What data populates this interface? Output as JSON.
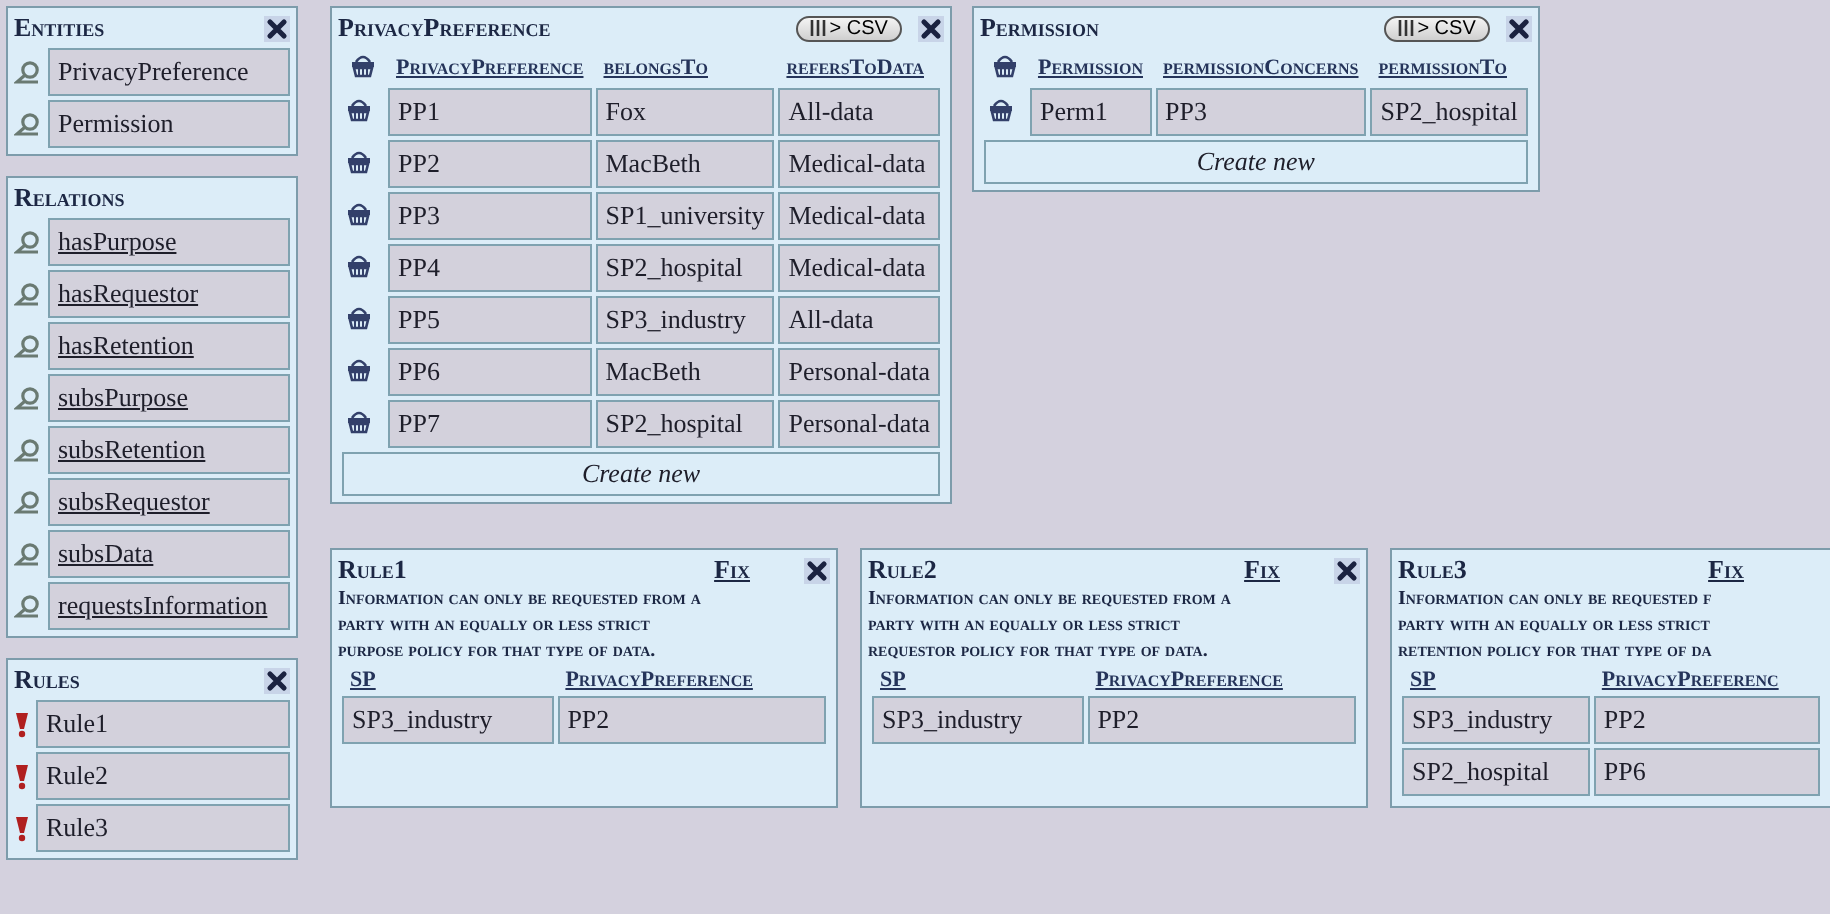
{
  "sidebar": [
    {
      "title": "Entities",
      "closable": true,
      "items": [
        {
          "label": "PrivacyPreference",
          "kind": "entity"
        },
        {
          "label": "Permission",
          "kind": "entity"
        }
      ]
    },
    {
      "title": "Relations",
      "closable": false,
      "items": [
        {
          "label": "hasPurpose",
          "kind": "relation"
        },
        {
          "label": "hasRequestor",
          "kind": "relation"
        },
        {
          "label": "hasRetention",
          "kind": "relation"
        },
        {
          "label": "subsPurpose",
          "kind": "relation"
        },
        {
          "label": "subsRetention",
          "kind": "relation"
        },
        {
          "label": "subsRequestor",
          "kind": "relation"
        },
        {
          "label": "subsData",
          "kind": "relation"
        },
        {
          "label": "requestsInformation",
          "kind": "relation"
        }
      ]
    },
    {
      "title": "Rules",
      "closable": true,
      "items": [
        {
          "label": "Rule1",
          "kind": "rule"
        },
        {
          "label": "Rule2",
          "kind": "rule"
        },
        {
          "label": "Rule3",
          "kind": "rule"
        }
      ]
    }
  ],
  "tables": [
    {
      "title": "PrivacyPreference",
      "csv_button": "> CSV",
      "columns": [
        "PrivacyPreference",
        "belongsTo",
        "refersToData"
      ],
      "rows": [
        [
          "PP1",
          "Fox",
          "All-data"
        ],
        [
          "PP2",
          "MacBeth",
          "Medical-data"
        ],
        [
          "PP3",
          "SP1_university",
          "Medical-data"
        ],
        [
          "PP4",
          "SP2_hospital",
          "Medical-data"
        ],
        [
          "PP5",
          "SP3_industry",
          "All-data"
        ],
        [
          "PP6",
          "MacBeth",
          "Personal-data"
        ],
        [
          "PP7",
          "SP2_hospital",
          "Personal-data"
        ]
      ],
      "create_new": "Create new"
    },
    {
      "title": "Permission",
      "csv_button": "> CSV",
      "columns": [
        "Permission",
        "permissionConcerns",
        "permissionTo"
      ],
      "rows": [
        [
          "Perm1",
          "PP3",
          "SP2_hospital"
        ]
      ],
      "create_new": "Create new"
    }
  ],
  "rules": [
    {
      "title": "Rule1",
      "fix": "Fix",
      "closable": true,
      "description_lines": [
        "Information can only be requested from a",
        "party with an equally or less strict",
        "purpose policy for that type of data."
      ],
      "columns": [
        "SP",
        "PrivacyPreference"
      ],
      "rows": [
        [
          "SP3_industry",
          "PP2"
        ]
      ]
    },
    {
      "title": "Rule2",
      "fix": "Fix",
      "closable": true,
      "description_lines": [
        "Information can only be requested from a",
        "party with an equally or less strict",
        "requestor policy for that type of data."
      ],
      "columns": [
        "SP",
        "PrivacyPreference"
      ],
      "rows": [
        [
          "SP3_industry",
          "PP2"
        ]
      ]
    },
    {
      "title": "Rule3",
      "fix": "Fix",
      "closable": false,
      "description_lines": [
        "Information can only be requested f",
        "party with an equally or less strict",
        "retention policy for that type of da"
      ],
      "columns": [
        "SP",
        "PrivacyPreferenc"
      ],
      "rows": [
        [
          "SP3_industry",
          "PP2"
        ],
        [
          "SP2_hospital",
          "PP6"
        ]
      ]
    }
  ]
}
